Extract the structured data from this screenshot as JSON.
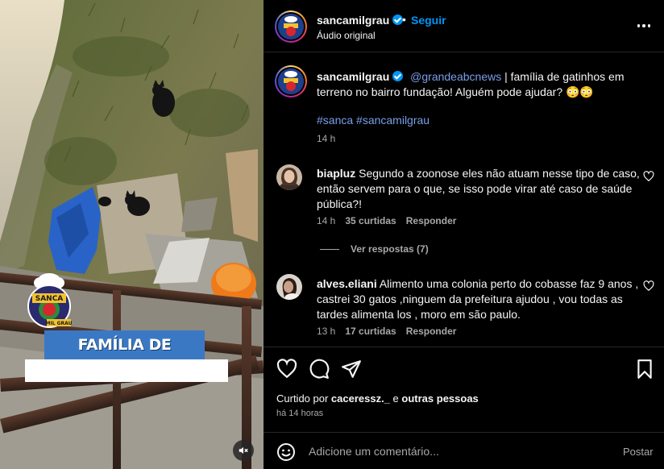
{
  "post": {
    "username": "sancamilgrau",
    "follow_label": "Seguir",
    "separator": "•",
    "subtitle": "Áudio original",
    "video_overlay_title": "FAMÍLIA DE GATINHOS",
    "logo_text_top": "SANCA",
    "logo_text_bottom": "MIL GRAU"
  },
  "caption": {
    "username": "sancamilgrau",
    "mention": "@grandeabcnews",
    "text": " | família de gatinhos em terreno no bairro fundação! Alguém pode ajudar? 😳😳",
    "hashtags": "#sanca #sancamilgrau",
    "time": "14 h"
  },
  "comments": [
    {
      "username": "biapluz",
      "text": " Segundo a zoonose eles não atuam nesse tipo de caso, então servem para o que, se isso pode virar até caso de saúde pública?!",
      "time": "14 h",
      "likes": "35 curtidas",
      "reply_label": "Responder",
      "view_replies": "Ver respostas (7)"
    },
    {
      "username": "alves.eliani",
      "text": " Alimento uma colonia perto do cobasse faz 9 anos , castrei 30 gatos ,ninguem da prefeitura ajudou , vou todas as tardes alimenta los , moro em são paulo.",
      "time": "13 h",
      "likes": "17 curtidas",
      "reply_label": "Responder"
    }
  ],
  "likes": {
    "prefix": "Curtido por ",
    "user": "caceressz._",
    "middle": " e ",
    "others": "outras pessoas"
  },
  "time_ago": "há 14 horas",
  "add_comment": {
    "placeholder": "Adicione um comentário...",
    "post_label": "Postar"
  },
  "icons": {
    "like": "heart-icon",
    "comment": "comment-icon",
    "share": "share-icon",
    "save": "bookmark-icon",
    "more": "more-options-icon",
    "emoji": "emoji-icon",
    "mute": "muted-speaker-icon",
    "verified": "verified-badge-icon"
  },
  "colors": {
    "link": "#0095f6",
    "mention": "#7a9ee9",
    "muted_text": "#a8a8a8",
    "background": "#000000"
  }
}
